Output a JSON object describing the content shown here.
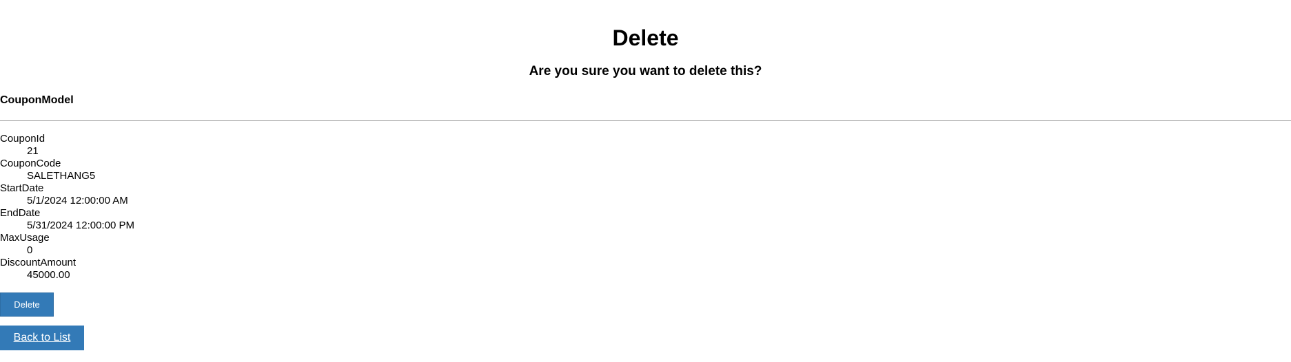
{
  "header": {
    "title": "Delete",
    "confirm_question": "Are you sure you want to delete this?"
  },
  "model": {
    "name": "CouponModel",
    "fields": [
      {
        "label": "CouponId",
        "value": "21"
      },
      {
        "label": "CouponCode",
        "value": "SALETHANG5"
      },
      {
        "label": "StartDate",
        "value": "5/1/2024 12:00:00 AM"
      },
      {
        "label": "EndDate",
        "value": "5/31/2024 12:00:00 PM"
      },
      {
        "label": "MaxUsage",
        "value": "0"
      },
      {
        "label": "DiscountAmount",
        "value": "45000.00"
      }
    ]
  },
  "actions": {
    "delete_label": "Delete",
    "back_label": "Back to List"
  },
  "colors": {
    "button_bg": "#337ab7",
    "button_text": "#ffffff",
    "divider": "#9a9a9a"
  }
}
